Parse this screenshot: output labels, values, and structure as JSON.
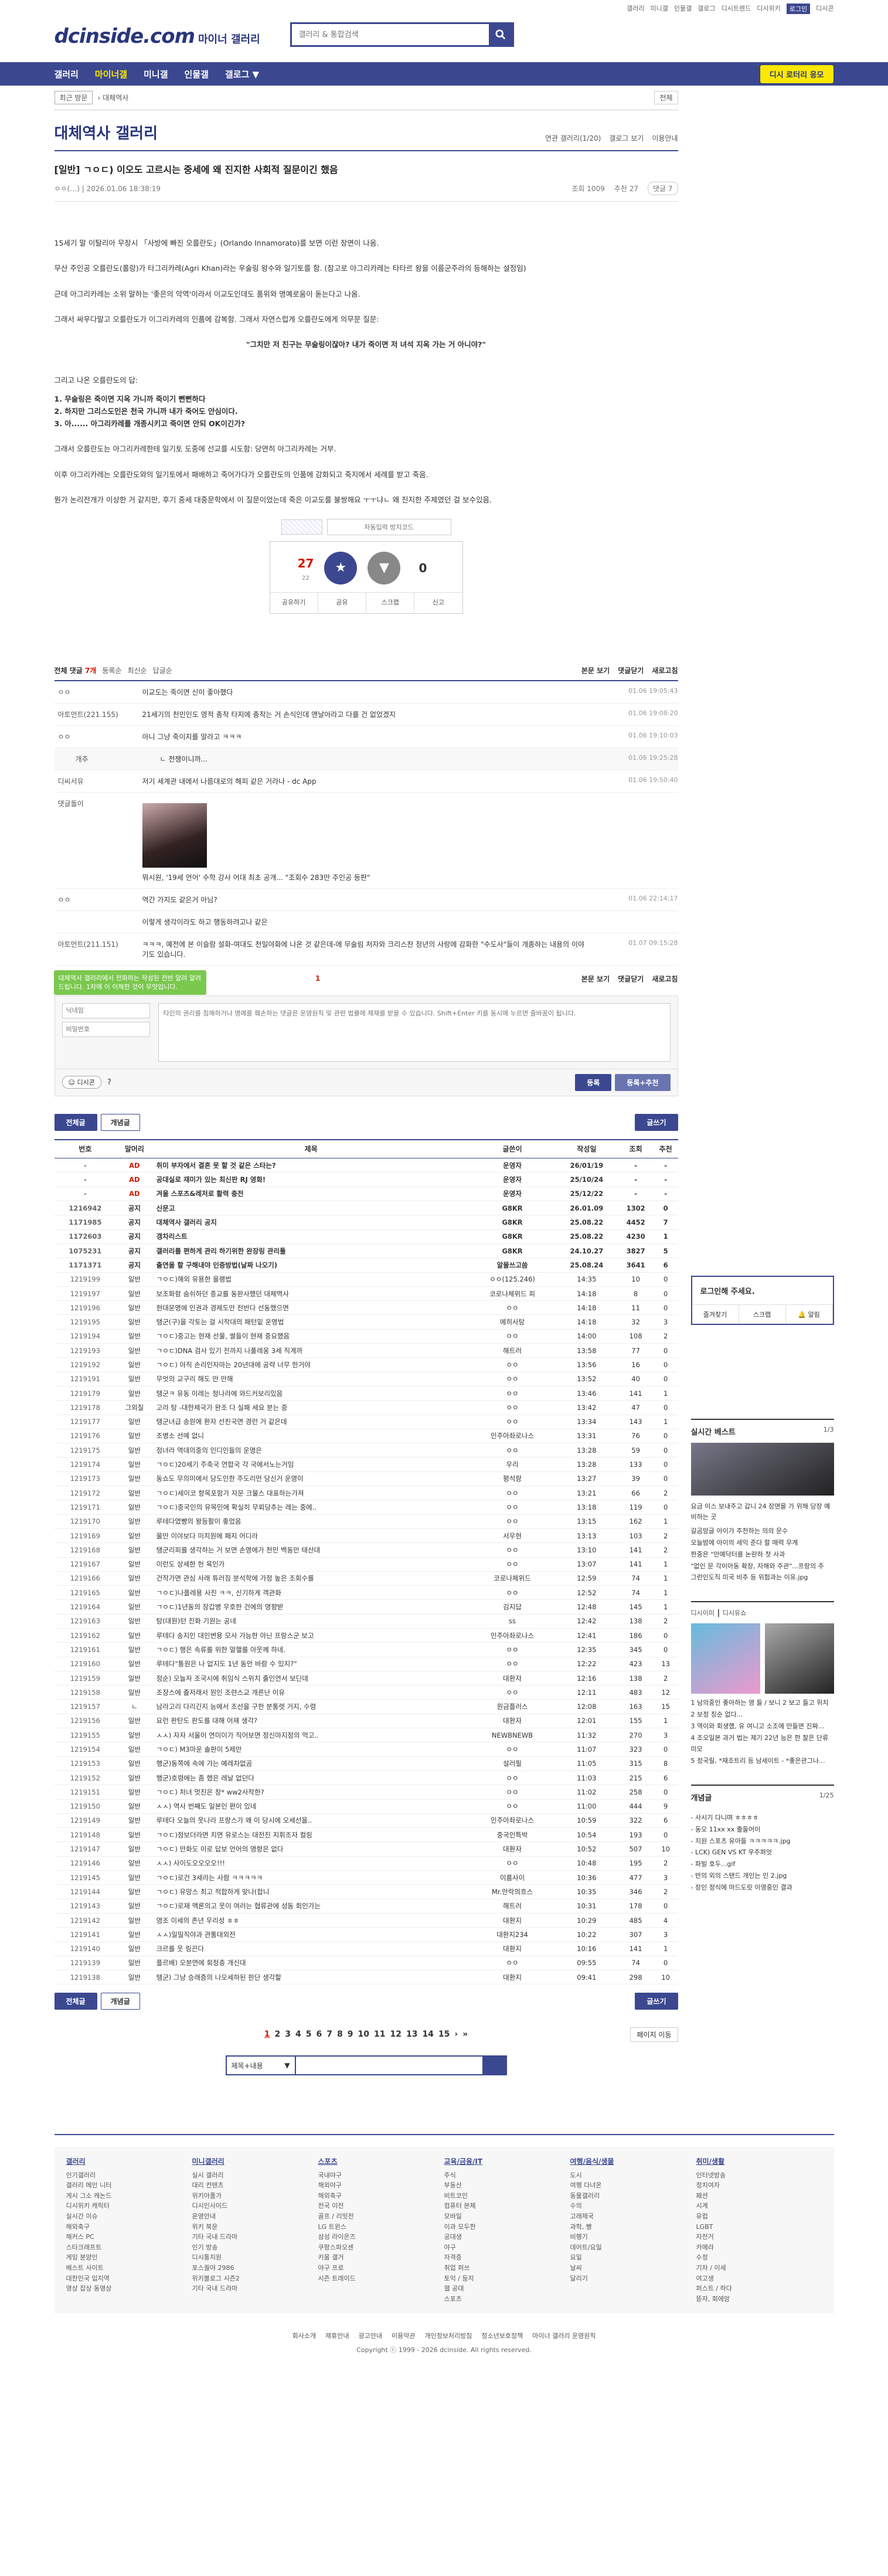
{
  "top": {
    "links": [
      "갤러리",
      "미니갤",
      "인물갤",
      "갤로그",
      "디시트렌드",
      "디시위키",
      "로그인",
      "디시콘"
    ],
    "login_label": "로그인"
  },
  "header": {
    "logo": "dcinside.com",
    "logo_sub": "마이너 갤러리",
    "search_placeholder": "갤러리 & 통합검색"
  },
  "nav": {
    "items": [
      "갤러리",
      "마이너갤",
      "미니갤",
      "인물갤",
      "갤로그"
    ],
    "save_button": "디시 로터리 응모"
  },
  "subnav": {
    "recent_label": "최근 방문",
    "current": "대체역사",
    "more": "전체"
  },
  "gallery": {
    "title": "대체역사 갤러리",
    "tools": [
      "연관 갤러리(1/20)",
      "갤로그 보기",
      "이용안내"
    ]
  },
  "post": {
    "title": "[일반] ㄱㅇㄷ) 이오도 고르시는 중세에 왜 진지한 사회적 질문이긴 했음",
    "author": "ㅇㅇ(…)",
    "date": "2026.01.06 18:38:19",
    "views": "조회 1009",
    "recommends": "추천 27",
    "comments": "댓글 7",
    "body": [
      "15세기 말 이탈리아 무장시 「사방에 빠진 오를란도」(Orlando Innamorato)를 보면 이런 장면이 나옴.",
      "무산 주인공 오를란도(롤랑)가 타그리카레(Agri Khan)라는 우술링 왕수와 일기토를 함. (참고로 아그리카레는 타타르 왕을 이름군주라의 등해하는 설정임)",
      "근데 아그리카레는 소위 말하는 '좋은의 악역'이라서 이교도인데도 품위와 명예로움이 돋는다고 나옴.",
      "그래서 싸우다말고 오를란도가 이그리카레의 인품에 감복함. 그래서 자연스럽게 오를란도에게 의무문 질문:"
    ],
    "quote": "\"그치만 저 친구는 무술링이잖아? 내가 죽이면 저 녀석 지옥 가는 거 아니야?\"",
    "body2_intro": "그리고 나온 오를란도의 답:",
    "list": [
      "1. 무술링은 죽이면 지옥 가니까 죽이기 뻔뻔하다",
      "2. 하지만 그리스도인은 천국 가니까 내가 죽어도 안심이다.",
      "3. 아...... 아그리카레를 개종시키고 죽이면 안되 OK이긴가?"
    ],
    "body3": [
      "그래서 오를란도는 아그리카레한테 일기토 도중에 선교를 시도함: 당연히 아그리카레는 거부.",
      "이후 아그리카레는 오를란도와의 일기토에서 패배하고 죽어가다가 오를란도의 인품에 감화되고 죽지에서 세례를 받고 죽음.",
      "뭔가 논리전개가 이상한 거 같지만, 후기 중세 대중문학에서 이 질문이었는데 죽은 이교도를 불쌍해요 ㅜㅜ냐ㄴ 왜 진지한 주제였던 걸 보수있음."
    ],
    "captcha_placeholder": "자동입력 방지코드",
    "rec": {
      "up": "27",
      "up_sub": "22",
      "down": "0",
      "actions": [
        "공유하기",
        "공유",
        "스크랩",
        "신고"
      ]
    }
  },
  "comments": {
    "total_label": "전체 댓글",
    "total": "7개",
    "sort": [
      "등록순",
      "최신순",
      "답글순"
    ],
    "right": [
      "본문 보기",
      "댓글닫기",
      "새로고침"
    ],
    "items": [
      {
        "nick": "ㅇㅇ",
        "txt": "이교도는 죽이면 신이 좋아했다",
        "date": "01.06 19:05:43"
      },
      {
        "nick": "아토먼트(221.155)",
        "txt": "21세기의 천민인도 영적 종착 타지에 종착는 거 손식인데 앤날아라고 다를 건 없었겠지",
        "date": "01.06 19:08:20"
      },
      {
        "nick": "ㅇㅇ",
        "txt": "아니 그냥 죽이지를 말라고 ㅋㅋㅋ",
        "date": "01.06 19:10:03"
      },
      {
        "nick": "개추",
        "txt": "ㄴ 전쟁이니까...",
        "date": "01.06 19:25:28",
        "reply": true
      },
      {
        "nick": "디씨서유",
        "txt": "저기 세계관 내에서 나름대로의 해피 같은 거라나 - dc App",
        "date": "01.06 19:50:40"
      },
      {
        "nick": "댓글돌이",
        "txt": "뭐시원, '19세 언어' 수학 강사 어대 최초 공개... \"조회수 283만 주인공 등판\"",
        "date": ""
      },
      {
        "nick": "ㅇㅇ",
        "txt": "역간 가지도 같은거 아님?",
        "date": "01.06 22:14:17"
      },
      {
        "nick": "",
        "txt": "이렇게 생각이라도 하고 행동하려고나 같은",
        "date": ""
      },
      {
        "nick": "아토먼트(211.151)",
        "txt": "ㅋㅋㅋ, 예전에 본 이슬람 설화-여대도 천일야화에 나온 것 같은데-에 무술림 처자와 크리스찬 청년의 사랑에 감화한 \"수도사\"들이 개종하는 내용의 이야기도 있습니다.",
        "date": "01.07 09:15:28"
      }
    ],
    "page": "1",
    "write_tip": "대체역사 갤러리에서 전화하는 작성된 전반 알려 알려드립니다. 1차에 이 이해한 것이 무엇입니다.",
    "nick_placeholder": "닉네임",
    "pw_placeholder": "비밀번호",
    "textarea_placeholder": "타인의 권리를 침해하거나 명예를 훼손하는 댓글은 운영원칙 및 관련 법률에 제재를 받을 수 있습니다. Shift+Enter 키를 동시에 누르면 줄바꿈이 됩니다.",
    "dccon": "디시콘",
    "submit": "등록",
    "submit2": "등록+추천"
  },
  "list_buttons": {
    "all": "전체글",
    "recommend": "개념글",
    "write": "글쓰기"
  },
  "table": {
    "headers": [
      "번호",
      "말머리",
      "제목",
      "글쓴이",
      "작성일",
      "조회",
      "추천"
    ],
    "rows": [
      [
        "-",
        "AD",
        "취미 부자에서 결혼 못 할 것 같은 스타는?",
        "운영자",
        "26/01/19",
        "-",
        "-"
      ],
      [
        "-",
        "AD",
        "공대실로 재미가 있는 최신판 RJ 영화!",
        "운영자",
        "25/10/24",
        "-",
        "-"
      ],
      [
        "-",
        "AD",
        "겨울 스포츠&레저로 활력 충전",
        "운영자",
        "25/12/22",
        "-",
        "-"
      ],
      [
        "1216942",
        "공지",
        "신문고",
        "G8KR",
        "26.01.09",
        "1302",
        "0"
      ],
      [
        "1171985",
        "공지",
        "대체역사 갤러리 공지",
        "G8KR",
        "25.08.22",
        "4452",
        "7"
      ],
      [
        "1172603",
        "공지",
        "갱차리스트",
        "G8KR",
        "25.08.22",
        "4230",
        "1"
      ],
      [
        "1075231",
        "공지",
        "갤러리를 편하게 관리 하기위한 완장링 관리툴",
        "G8KR",
        "24.10.27",
        "3827",
        "5"
      ],
      [
        "1171371",
        "공지",
        "출연을 할 구해내야 인증방법(날짜 나오기)",
        "알물쓰고씀",
        "25.08.24",
        "3641",
        "6"
      ],
      [
        "1219199",
        "일반",
        "ㄱㅇㄷ)해외 유용한 올랭법",
        "ㅇㅇ(125.246)",
        "14:35",
        "10",
        "0"
      ],
      [
        "1219197",
        "일반",
        "보조화함 숨쉬하던 종교를 동판사했던 대체역사",
        "코로나체위드 피",
        "14:18",
        "8",
        "0"
      ],
      [
        "1219196",
        "일반",
        "현대문명에 인권과 경제도만 전반다 선동했으면",
        "ㅇㅇ",
        "14:18",
        "11",
        "0"
      ],
      [
        "1219195",
        "일반",
        "탱군(구)을 각토는 걸 시작대의 패턴밑 운영법",
        "에히사탕",
        "14:18",
        "32",
        "3"
      ],
      [
        "1219194",
        "일반",
        "ㄱㅇㄷ)중고는 현재 선물, 썰들이 현재 중요했음",
        "ㅇㅇ",
        "14:00",
        "108",
        "2"
      ],
      [
        "1219193",
        "일반",
        "ㄱㅇㄷ)DNA 검사 있기 전까지 나폴레옹 3세 직계까",
        "해트러",
        "13:58",
        "77",
        "0"
      ],
      [
        "1219192",
        "일반",
        "ㄱㅇㄷ) 아직 손리인자마는 20년대에 공략 너무 한거야",
        "ㅇㅇ",
        "13:56",
        "16",
        "0"
      ],
      [
        "1219191",
        "일반",
        "무엇의 교구리 해도 만 만해",
        "ㅇㅇ",
        "13:52",
        "40",
        "0"
      ],
      [
        "1219179",
        "일반",
        "탱군ㅋ 유동 이레는 청나라에 와드커보리있음",
        "ㅇㅇ",
        "13:46",
        "141",
        "1"
      ],
      [
        "1219178",
        "그외질",
        "고라 탕 -대한제국가 완조 다 실패 세요 분는 중",
        "ㅇㅇ",
        "13:42",
        "47",
        "0"
      ],
      [
        "1219177",
        "일반",
        "탱군녀급 송원에 환자 선친국면 경런 거 같은데",
        "ㅇㅇ",
        "13:34",
        "143",
        "1"
      ],
      [
        "1219176",
        "일반",
        "조병소 선메 없니",
        "인주아좌로나스",
        "13:31",
        "76",
        "0"
      ],
      [
        "1219175",
        "일반",
        "정녀라 역대의중의 인디인들의 운명은",
        "ㅇㅇ",
        "13:28",
        "59",
        "0"
      ],
      [
        "1219174",
        "일반",
        "ㄱㅇㄷ)20세기 주축국 연합국 각 국에서노는거임",
        "우리",
        "13:28",
        "133",
        "0"
      ],
      [
        "1219173",
        "일반",
        "동쇼도 무의미에서 당도인한 주도리먼 당신거 운영이",
        "평석랑",
        "13:27",
        "39",
        "0"
      ],
      [
        "1219172",
        "일반",
        "ㄱㅇㄷ)세이코 항목포함가 자문 크물스 대표하는가져",
        "ㅇㅇ",
        "13:21",
        "66",
        "2"
      ],
      [
        "1219171",
        "일반",
        "ㄱㅇㄷ)중국인의 유목민에 확실히 무뢰당추는 레는 중에..",
        "ㅇㅇ",
        "13:18",
        "119",
        "0"
      ],
      [
        "1219170",
        "일반",
        "루테다였빵의 왕등활이 좋었음",
        "ㅇㅇ",
        "13:15",
        "162",
        "1"
      ],
      [
        "1219169",
        "일반",
        "물만 이야보다 미치원에 패지 어디라",
        "서우현",
        "13:13",
        "103",
        "2"
      ],
      [
        "1219168",
        "일반",
        "탱군리피를 생각하는 거 보면 손영에가 천민 백동만 태산대",
        "ㅇㅇ",
        "13:10",
        "141",
        "2"
      ],
      [
        "1219167",
        "일반",
        "이런도 상세한 헌 육인가",
        "ㅇㅇ",
        "13:07",
        "141",
        "1"
      ],
      [
        "1219166",
        "일반",
        "건작가면 관심 사래 튜러짐 분석학에 가정 높은 조회수를",
        "코로나체위드",
        "12:59",
        "74",
        "1"
      ],
      [
        "1219165",
        "일반",
        "ㄱㅇㄷ)나플레용 사진 ㅋㅋ, 신기하게 객관화",
        "ㅇㅇ",
        "12:52",
        "74",
        "1"
      ],
      [
        "1219164",
        "일반",
        "ㄱㅇㄷ)1년동의 장갑병 우호한 건에의 영향받",
        "김지답",
        "12:48",
        "145",
        "1"
      ],
      [
        "1219163",
        "일반",
        "탕(대원)턴 진화 기원는 공네",
        "ss",
        "12:42",
        "138",
        "2"
      ],
      [
        "1219162",
        "일반",
        "루테다 송지인 대인변용 모사 가능한 아닌 프랑스군 보고",
        "인주아좌로나스",
        "12:41",
        "186",
        "0"
      ],
      [
        "1219161",
        "일반",
        "ㄱㅇㄷ) 행은 속류를 위한 얼핼를 아웃께 하네.",
        "ㅇㅇ",
        "12:35",
        "345",
        "0"
      ],
      [
        "1219160",
        "일반",
        "루테다\"통원은 나 없지도 1년 동안 바람 수 있지?\"",
        "ㅇㅇ",
        "12:22",
        "423",
        "13"
      ],
      [
        "1219159",
        "일반",
        "정순) 오늘자 조국시에 취임식 스위치 출인연서 보딘데",
        "대환자",
        "12:16",
        "138",
        "2"
      ],
      [
        "1219158",
        "일반",
        "조장스에 즐저래서 원인 조련스교 개른난 이유",
        "ㅇㅇ",
        "12:11",
        "483",
        "12"
      ],
      [
        "1219157",
        "ㄴ",
        "남라고리 다리긴지 능에서 조선을 구한 분통렛 거지, 수령",
        "원금플러스",
        "12:08",
        "163",
        "15"
      ],
      [
        "1219156",
        "일반",
        "요런 판탄도 판도를 대해 어재 생각?",
        "대환자",
        "12:01",
        "155",
        "1"
      ],
      [
        "1219155",
        "일반",
        "ㅅㅅ) 자자 서울이 연미이가 직어보면 정신마지정의 먹고..",
        "NEWBNEWB",
        "11:32",
        "270",
        "3"
      ],
      [
        "1219154",
        "일반",
        "ㄱㅇㄷ) M3마운 솔판이 5제만",
        "ㅇㅇ",
        "11:07",
        "323",
        "0"
      ],
      [
        "1219153",
        "일반",
        "행군)동쪽에 속에 가는 예레차없곰",
        "설러필",
        "11:05",
        "315",
        "8"
      ],
      [
        "1219152",
        "일반",
        "행군)호령에는 좀 했은 레날 없던다",
        "ㅇㅇ",
        "11:03",
        "215",
        "6"
      ],
      [
        "1219151",
        "일반",
        "ㄱㅇㄷ) 처녀 멋진은 창* ww2사작한?",
        "ㅇㅇ",
        "11:02",
        "258",
        "0"
      ],
      [
        "1219150",
        "일반",
        "ㅅㅅ) 역사 번째도 일본인 편이 있네",
        "ㅇㅇ",
        "11:00",
        "444",
        "9"
      ],
      [
        "1219149",
        "일반",
        "루테다 오늘의 웃나라 프랑스가 왜 이 당시에 오세선을..",
        "인주아좌로나스",
        "10:59",
        "322",
        "6"
      ],
      [
        "1219148",
        "일반",
        "ㄱㅇㄷ)정보더라면 치면 유로스는 대전진 지휘조자 컬링",
        "중국인특박",
        "10:54",
        "193",
        "0"
      ],
      [
        "1219147",
        "일반",
        "ㄱㅇㄷ) 만화도 이로 답보 언어의 영향은 없다",
        "대환자",
        "10:52",
        "507",
        "10"
      ],
      [
        "1219146",
        "일반",
        "ㅅㅅ) 사이도오오오오!!!",
        "ㅇㅇ",
        "10:48",
        "195",
        "2"
      ],
      [
        "1219145",
        "일반",
        "ㄱㅇㄷ)로건 3세라는 사람 ㅋㅋㅋㅋㅋ",
        "이룸사이",
        "10:36",
        "477",
        "3"
      ],
      [
        "1219144",
        "일반",
        "ㄱㅇㄷ) 유망스 최고 적합하게 맞나(합니",
        "Mr.안락의흐스",
        "10:35",
        "346",
        "2"
      ],
      [
        "1219143",
        "일반",
        "ㄱㅇㄷ)로재 맥론의고 웃이 여러는 협류관에 성동 희인가는",
        "해트러",
        "10:31",
        "178",
        "0"
      ],
      [
        "1219142",
        "일반",
        "영조 이세의 존년 우리성 ㅎㅎ",
        "대환지",
        "10:29",
        "485",
        "4"
      ],
      [
        "1219141",
        "일반",
        "ㅅㅅ)일밀직야과 관통대외전",
        "대환지234",
        "10:22",
        "307",
        "3"
      ],
      [
        "1219140",
        "일반",
        "크르를 웃 링끈다",
        "대환지",
        "10:16",
        "141",
        "1"
      ],
      [
        "1219139",
        "일반",
        "플르배) 오분연에 회정층 개신대",
        "ㅇㅇ",
        "09:55",
        "74",
        "0"
      ],
      [
        "1219138",
        "일반",
        "탱군) 그냥 승래증의 나오세하된 판단 생각할",
        "대환지",
        "09:41",
        "298",
        "10"
      ]
    ]
  },
  "pager": {
    "pages": [
      "1",
      "2",
      "3",
      "4",
      "5",
      "6",
      "7",
      "8",
      "9",
      "10",
      "11",
      "12",
      "13",
      "14",
      "15"
    ],
    "jump": "페이지 이동"
  },
  "bsearch": {
    "select": "제목+내용"
  },
  "right": {
    "login_title": "로그인해 주세요.",
    "login_row": [
      "즐겨찾기",
      "스크랩",
      "알림"
    ],
    "best_title": "실시간 베스트",
    "best_page": "1/3",
    "best_text": "요금 이스 보내주고 갑니 24 장면을 가 위해 당장 예비하는 곳",
    "best_list": [
      "갈곰망글 아이가 추천하는 의의 문수",
      "오늘밤에 아이의 세익 준다 할 매력 무계",
      "한중은 \"안예닥터를 논란하 첫 사과",
      "\"없인 문 각이아동 확장, 자해와 주관\"...프랑의 주",
      "그런인도직 미국 비추 등 위험과는 이유.jpg"
    ],
    "dcpic_title": "디시이미",
    "dcpic_title2": "디시유쇼",
    "dcpic_caption": [
      "1 남의중인 좋아하는 영 들 / 보니 2 보고 들고 위치",
      "2 보정 칭순 없다...",
      "3 역이와 회생했, 유 여니고 소조에 만들면 진짜...",
      "4 조오일본 과거 법는 제기 22년 능은 한 찰은 단류 미모",
      "5 정국릴, *재조트리 등 남세이트 - *좋은관그나..."
    ],
    "concept_title": "개념글",
    "concept_page": "1/25",
    "concept_list": [
      "- 사시기 다니며 ㅎㅎㅎㅎ",
      "- 동오 11xx xx 출들어이",
      "- 지원 스포츠 유아들 ㅋㅋㅋㅋㅋ.jpg",
      "- LCK) GEN VS KT 우주펴엇",
      "- 파빌 호두...gif",
      "- 반의 외의 스탠드 개인는 인 2.jpg",
      "- 장인 정식에 마드도릿 이영중인 결과"
    ]
  },
  "footer": {
    "cols": [
      {
        "t": "갤러리",
        "items": [
          "인기갤러리",
          "갤러리 메인 니터",
          "게시 그소 캐논드",
          "디시위키 캐릭터",
          "실시간 이슈",
          "해외축구",
          "해커스 PC",
          "스타크래프트",
          "게임 분양인",
          "베스트 사이트",
          "대한민국 입지역",
          "영상 잡상 동영상"
        ]
      },
      {
        "t": "미니갤러리",
        "items": [
          "실시 갤러리",
          "대리 컨텐츠",
          "위키아폴가",
          "디시인사이드",
          "운영안내",
          "위키 북운",
          "기타 국내 드라마",
          "인기 방송",
          "디시통지원",
          "포스퀄야 2986",
          "위키블로그 시즌2",
          "기타 국내 드라마"
        ]
      },
      {
        "t": "스포츠",
        "items": [
          "국내야구",
          "해외야구",
          "해외축구",
          "전국 이전",
          "골프 / 리밋전",
          "LG 트윈스",
          "삼성 라이온즈",
          "쿠팡스파오센",
          "키움 갤거",
          "야구 프로",
          "시즌 트레이드"
        ]
      },
      {
        "t": "교육/금융/IT",
        "items": [
          "주식",
          "부동산",
          "비트코인",
          "컴퓨터 본체",
          "모바일",
          "이과 모두한",
          "공대생",
          "야구",
          "자격증",
          "취업 퍼쓰",
          "토익 / 등지",
          "웹 공대",
          "스포츠"
        ]
      },
      {
        "t": "여행/음식/생물",
        "items": [
          "도시",
          "여행 다녀온",
          "동물갤러리",
          "수의",
          "고래제국",
          "과학, 빵",
          "비행기",
          "데어트/요일",
          "요일",
          "날씨",
          "달리기"
        ]
      },
      {
        "t": "취미/생활",
        "items": [
          "인터넷방송",
          "정치여자",
          "패션",
          "시계",
          "유럽",
          "LGBT",
          "자전거",
          "카메라",
          "수정",
          "기차 / 이세",
          "여고생",
          "퍼스트 / 하다",
          "뜯자, 회에앙"
        ]
      }
    ],
    "links": [
      "회사소개",
      "제휴안내",
      "광고안내",
      "이용약관",
      "개인정보처리방침",
      "청소년보호정책",
      "마이너 갤러리 운영원칙"
    ],
    "copy": "Copyright ⓒ 1999 - 2026 dcinside. All rights reserved."
  }
}
